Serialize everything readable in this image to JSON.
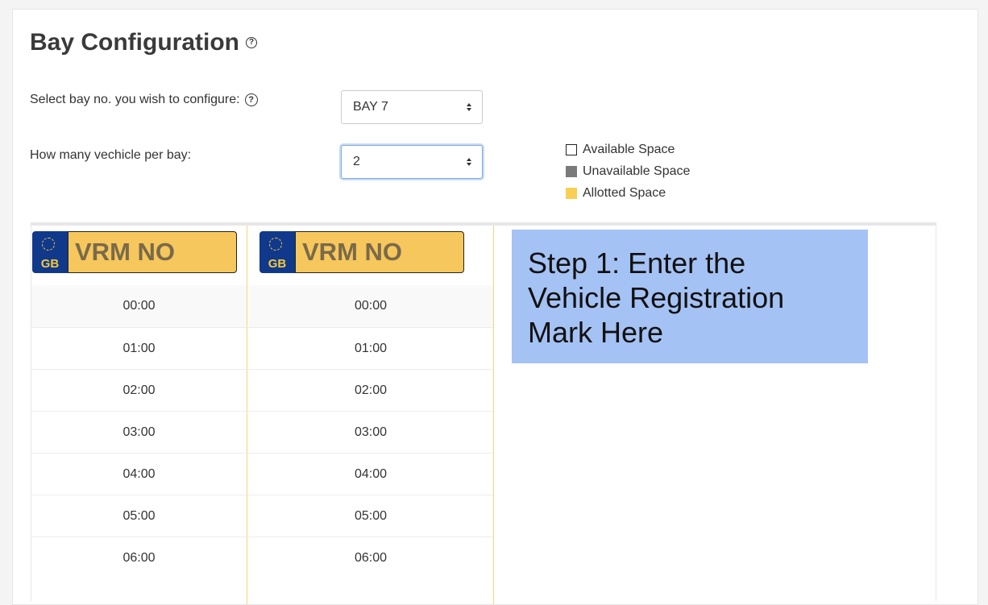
{
  "page": {
    "title": "Bay Configuration",
    "title_help_icon": "help-circle-icon"
  },
  "bay_select": {
    "label": "Select bay no. you wish to configure:",
    "help_icon": "help-circle-icon",
    "value": "BAY 7"
  },
  "vehicle_select": {
    "label": "How many vechicle per bay:",
    "value": "2"
  },
  "legend": {
    "items": [
      {
        "label": "Available Space",
        "color": "#ffffff"
      },
      {
        "label": "Unavailable Space",
        "color": "#7a7a7a"
      },
      {
        "label": "Allotted Space",
        "color": "#f8cf55"
      }
    ]
  },
  "plates": [
    {
      "country": "GB",
      "placeholder": "VRM NO"
    },
    {
      "country": "GB",
      "placeholder": "VRM NO"
    }
  ],
  "times": [
    "00:00",
    "01:00",
    "02:00",
    "03:00",
    "04:00",
    "05:00",
    "06:00"
  ],
  "callout": {
    "line1": "Step 1: Enter the",
    "line2": "Vehicle Registration",
    "line3": "Mark Here",
    "color": "#a4c2f4"
  }
}
